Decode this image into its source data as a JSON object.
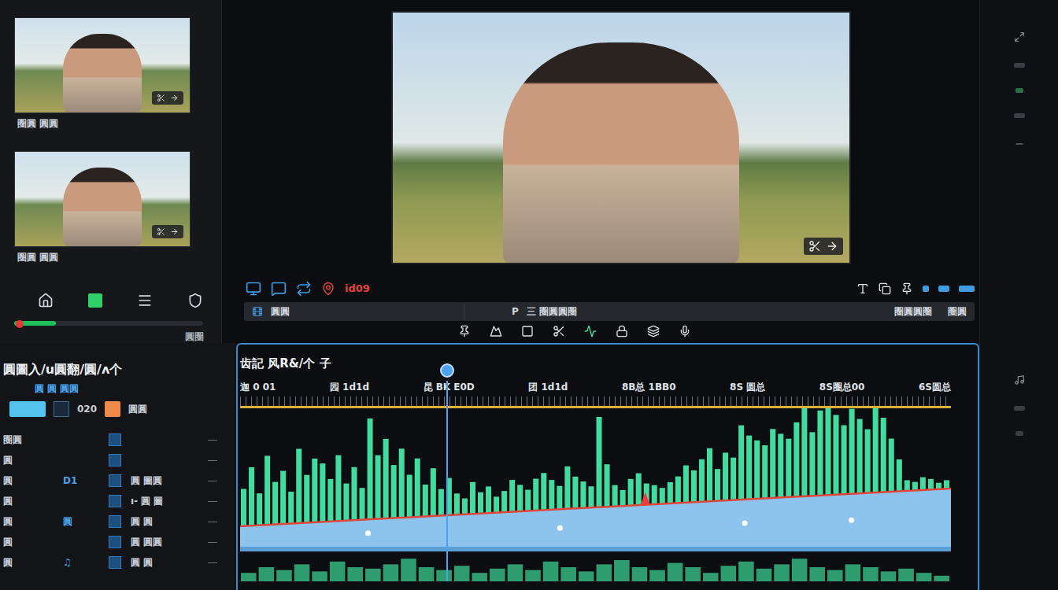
{
  "thumbnails": [
    {
      "caption": "圈圓 圓圓"
    },
    {
      "caption": "圈圓 圓圓"
    }
  ],
  "left_progress": {
    "level": 0.22
  },
  "left_footer": "圓圈",
  "preview_controls": {
    "timecode": "id09"
  },
  "header_bar": {
    "left": "圓圓",
    "marker": "P",
    "middle": "三 圈圓圓圈",
    "right": "圈圓圓圈",
    "far": "圈圓"
  },
  "track_panel": {
    "title": "圓圖入/u圓翻/圓/ʌ个",
    "buttons": "圓 圓 圓圓",
    "value": "020",
    "label": "圓圓",
    "tracks": [
      {
        "label": "圈圓"
      },
      {
        "label": "圓"
      },
      {
        "label": "圓",
        "tag": "D1",
        "value": "圓 圖圓"
      },
      {
        "label": "圓",
        "value": "ı- 圓 圖"
      },
      {
        "label": "圓",
        "tag": "圓",
        "value": "圓 圓"
      },
      {
        "label": "圓",
        "value": "圓 圓圓"
      },
      {
        "label": "圓",
        "tag": "♫",
        "value": "圓 圓"
      }
    ]
  },
  "timeline": {
    "title": "齿記 风R&/个  子",
    "ruler": [
      "迦 0 01",
      "园 1d1d",
      "昆 BK E0D",
      "团 1d1d",
      "8B总 1BB0",
      "8S 圆总",
      "8S圈总00",
      "6S圆总"
    ],
    "playhead": 0.29,
    "marker": 0.57,
    "keyframes": [
      0.18,
      0.45,
      0.71,
      0.86
    ],
    "waveform": [
      0.35,
      0.55,
      0.3,
      0.65,
      0.4,
      0.5,
      0.3,
      0.7,
      0.45,
      0.6,
      0.55,
      0.4,
      0.62,
      0.35,
      0.5,
      0.3,
      0.95,
      0.6,
      0.75,
      0.5,
      0.65,
      0.4,
      0.55,
      0.3,
      0.45,
      0.25,
      0.35,
      0.2,
      0.15,
      0.3,
      0.2,
      0.25,
      0.15,
      0.2,
      0.3,
      0.25,
      0.2,
      0.3,
      0.35,
      0.28,
      0.22,
      0.4,
      0.3,
      0.25,
      0.2,
      0.85,
      0.4,
      0.2,
      0.15,
      0.25,
      0.3,
      0.2,
      0.18,
      0.15,
      0.2,
      0.25,
      0.35,
      0.3,
      0.4,
      0.5,
      0.3,
      0.45,
      0.4,
      0.7,
      0.6,
      0.55,
      0.5,
      0.65,
      0.6,
      0.55,
      0.7,
      0.95,
      0.6,
      0.8,
      0.9,
      0.75,
      0.65,
      0.8,
      0.7,
      0.6,
      0.85,
      0.7,
      0.5,
      0.3,
      0.1,
      0.08,
      0.12,
      0.1,
      0.06,
      0.08
    ],
    "lower_waveform": [
      0.3,
      0.5,
      0.4,
      0.6,
      0.35,
      0.7,
      0.5,
      0.45,
      0.6,
      0.8,
      0.5,
      0.4,
      0.55,
      0.3,
      0.45,
      0.6,
      0.4,
      0.7,
      0.5,
      0.35,
      0.6,
      0.75,
      0.5,
      0.4,
      0.65,
      0.5,
      0.3,
      0.55,
      0.7,
      0.45,
      0.6,
      0.8,
      0.5,
      0.4,
      0.6,
      0.5,
      0.35,
      0.45,
      0.3,
      0.2
    ]
  }
}
